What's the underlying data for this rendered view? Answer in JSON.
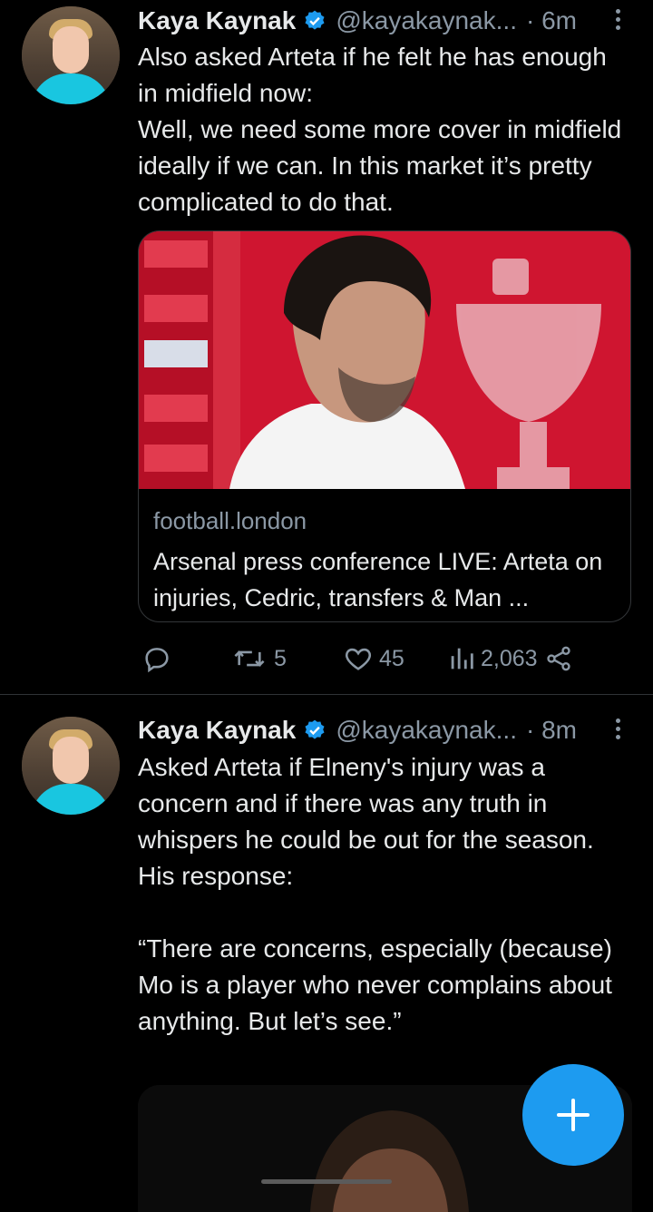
{
  "tweets": [
    {
      "name": "Kaya Kaynak",
      "handle": "@kayakaynak...",
      "time": "· 6m",
      "text": "Also asked Arteta if he felt he has enough in midfield now:\nWell, we need some more cover in midfield ideally if we can. In this market it’s pretty complicated to do that.",
      "card": {
        "domain": "football.london",
        "title": "Arsenal press conference LIVE: Arteta on injuries, Cedric, transfers & Man ..."
      },
      "actions": {
        "retweets": "5",
        "likes": "45",
        "views": "2,063"
      }
    },
    {
      "name": "Kaya Kaynak",
      "handle": "@kayakaynak...",
      "time": "· 8m",
      "text": "Asked Arteta if Elneny's injury was a concern and if there was any truth in whispers he could be out for the season. His response:\n\n“There are concerns, especially (because) Mo is a player who never complains about anything. But let’s see.”"
    }
  ],
  "colors": {
    "accent": "#1d9bf0",
    "background": "#000000",
    "secondary_text": "#8b98a5"
  },
  "icons": [
    "verified-badge-icon",
    "more-icon",
    "reply-icon",
    "retweet-icon",
    "like-icon",
    "views-icon",
    "share-icon",
    "compose-plus-icon"
  ]
}
